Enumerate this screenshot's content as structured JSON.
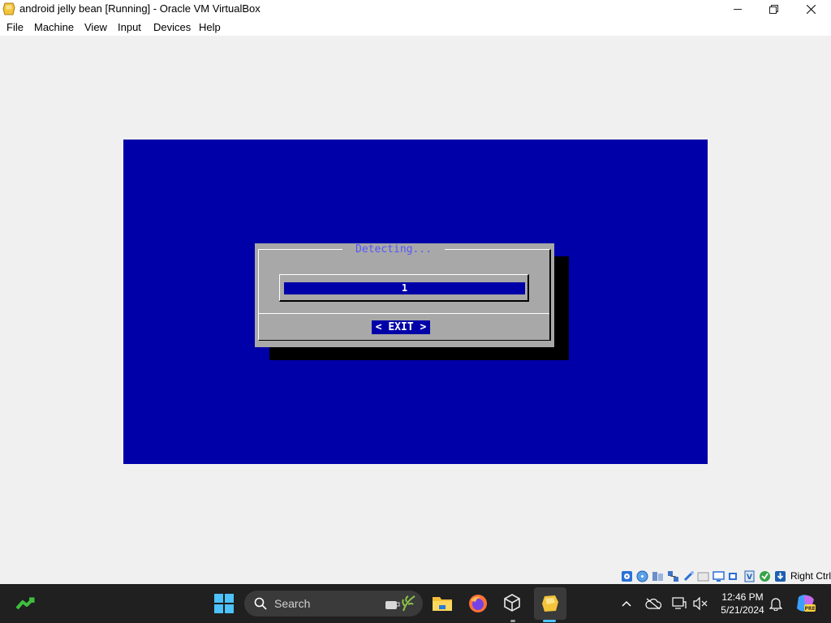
{
  "window": {
    "title": "android jelly bean [Running] - Oracle VM VirtualBox"
  },
  "menu": {
    "items": [
      "File",
      "Machine",
      "View",
      "Input",
      "Devices",
      "Help"
    ]
  },
  "vm": {
    "dialog_title": "Detecting...",
    "gauge_value": "1",
    "gauge_progress_percent": 1,
    "exit_button": "< EXIT >",
    "colors": {
      "screen": "#0000a8",
      "dialog": "#a8a8a8",
      "title_text": "#5656ff"
    }
  },
  "status_bar": {
    "icons": [
      "hard-disk-icon",
      "optical-drive-icon",
      "audio-icon",
      "network-icon",
      "usb-icon",
      "shared-folders-icon",
      "display-icon",
      "recording-icon",
      "cpu-icon",
      "guest-additions-icon",
      "mouse-integration-icon"
    ],
    "host_key": "Right Ctrl"
  },
  "taskbar": {
    "search_placeholder": "Search",
    "time": "12:46 PM",
    "date": "5/21/2024"
  }
}
